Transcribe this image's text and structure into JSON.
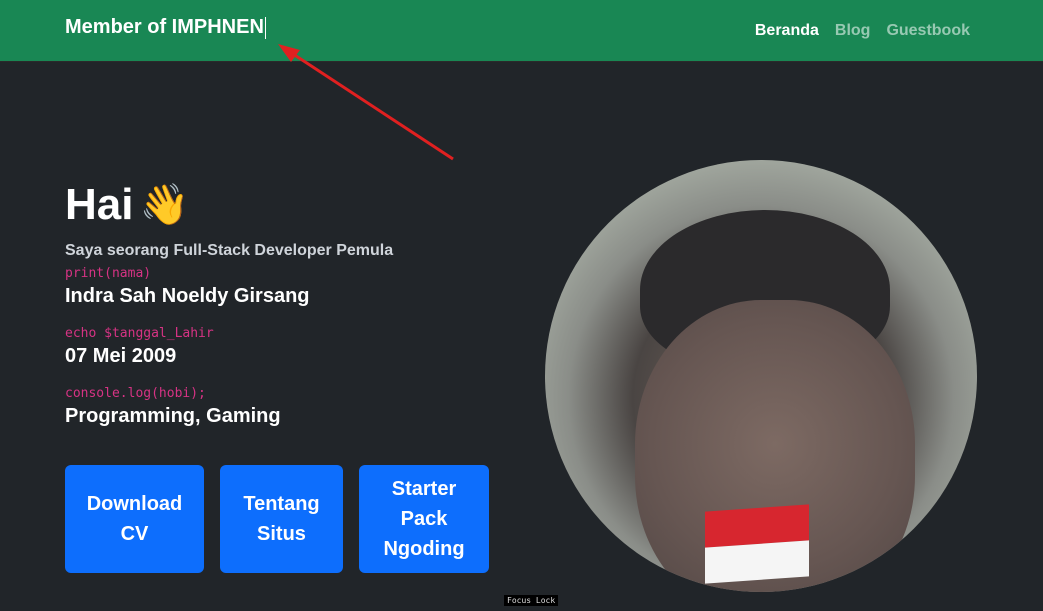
{
  "navbar": {
    "brand": "Member of IMPHNEN",
    "links": [
      {
        "label": "Beranda",
        "active": true
      },
      {
        "label": "Blog",
        "active": false
      },
      {
        "label": "Guestbook",
        "active": false
      }
    ]
  },
  "hero": {
    "greeting": "Hai",
    "greeting_emoji": "👋",
    "subtitle": "Saya seorang Full-Stack Developer Pemula",
    "fields": [
      {
        "code": "print(nama)",
        "value": "Indra Sah Noeldy Girsang"
      },
      {
        "code": "echo $tanggal_Lahir",
        "value": "07 Mei 2009"
      },
      {
        "code": "console.log(hobi);",
        "value": "Programming, Gaming"
      }
    ]
  },
  "buttons": [
    {
      "label_lines": [
        "Download",
        "CV"
      ]
    },
    {
      "label_lines": [
        "Tentang",
        "Situs"
      ]
    },
    {
      "label_lines": [
        "Starter",
        "Pack",
        "Ngoding"
      ]
    }
  ],
  "focus_label": "Focus Lock",
  "colors": {
    "navbar": "#198754",
    "background": "#212529",
    "button": "#0d6efd",
    "code": "#d63384",
    "arrow": "#e02020"
  }
}
